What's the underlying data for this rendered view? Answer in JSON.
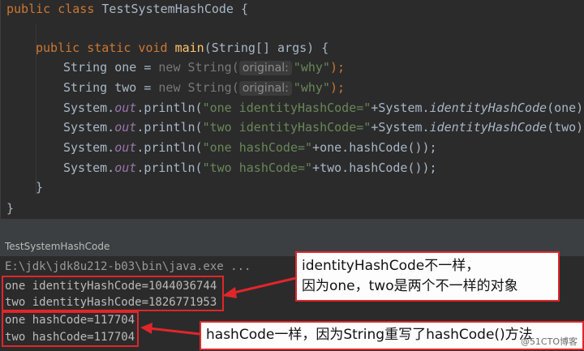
{
  "code": {
    "class_kw": "public class",
    "class_name": "TestSystemHashCode",
    "open_brace": "{",
    "method_kw": "public static void",
    "method_name": "main",
    "method_sig": "(String[] args) {",
    "l3_a": "String one = ",
    "l3_new": "new String(",
    "hint_label": "original:",
    "l3_str": "\"why\"",
    "l3_end": ");",
    "l4_a": "String two = ",
    "println_prefix": "System.",
    "out": "out",
    "println": ".println(",
    "s1": "\"one identityHashCode=\"",
    "s2": "\"two identityHashCode=\"",
    "s3": "\"one hashCode=\"",
    "s4": "\"two hashCode=\"",
    "plus_system": "+System.",
    "identity_fn": "identityHashCode",
    "arg_one": "(one));",
    "arg_two": "(two));",
    "plus_one_hash": "+one.hashCode());",
    "plus_two_hash": "+two.hashCode());",
    "close1": "}",
    "close2": "}"
  },
  "console": {
    "tab_label": "TestSystemHashCode",
    "cmd": "E:\\jdk\\jdk8u212-b03\\bin\\java.exe ...",
    "out1": "one identityHashCode=1044036744",
    "out2": "two identityHashCode=1826771953",
    "out3": "one hashCode=117704",
    "out4": "two hashCode=117704"
  },
  "annotations": {
    "note1_line1": "identityHashCode不一样，",
    "note1_line2": "因为one，two是两个不一样的对象",
    "note2": "hashCode一样，因为String重写了hashCode()方法",
    "accent_color": "#e0262a"
  },
  "watermark": "@51CTO博客"
}
